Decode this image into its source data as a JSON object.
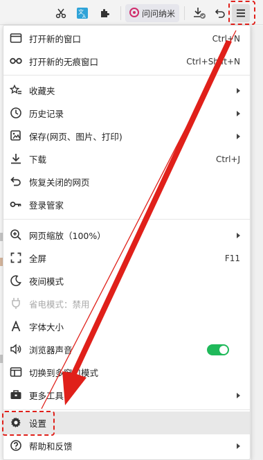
{
  "toolbar": {
    "extension_chip_label": "问问纳米",
    "buttons": [
      "scissors-icon",
      "translate-icon",
      "puzzle-icon",
      "download-icon",
      "undo-icon",
      "hamburger-menu-icon"
    ]
  },
  "menu": {
    "new_window": {
      "label": "打开新的窗口",
      "shortcut": "Ctrl+N"
    },
    "new_incognito": {
      "label": "打开新的无痕窗口",
      "shortcut": "Ctrl+Shift+N"
    },
    "favorites": {
      "label": "收藏夹"
    },
    "history": {
      "label": "历史记录"
    },
    "save": {
      "label": "保存(网页、图片、打印)"
    },
    "downloads": {
      "label": "下载",
      "shortcut": "Ctrl+J"
    },
    "restore_closed": {
      "label": "恢复关闭的网页"
    },
    "login_manager": {
      "label": "登录管家"
    },
    "zoom": {
      "label": "网页缩放（100%）"
    },
    "fullscreen": {
      "label": "全屏",
      "shortcut": "F11"
    },
    "night_mode": {
      "label": "夜间模式"
    },
    "power_save": {
      "label": "省电模式：禁用"
    },
    "font_size": {
      "label": "字体大小"
    },
    "browser_sound": {
      "label": "浏览器声音",
      "toggle_on": true
    },
    "multi_window": {
      "label": "切换到多窗口模式"
    },
    "more_tools": {
      "label": "更多工具"
    },
    "settings": {
      "label": "设置"
    },
    "help": {
      "label": "帮助和反馈"
    }
  },
  "annotation": {
    "color": "#e0201a"
  }
}
